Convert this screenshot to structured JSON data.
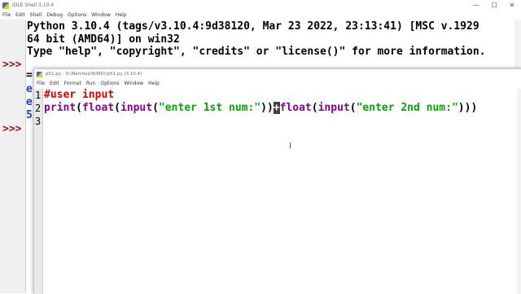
{
  "shell": {
    "title": "IDLE Shell 3.10.4",
    "window_controls": {
      "minimize": "—",
      "maximize": "☐",
      "close": "✕"
    },
    "menu": [
      "File",
      "Edit",
      "Shell",
      "Debug",
      "Options",
      "Window",
      "Help"
    ],
    "lines": [
      "Python 3.10.4 (tags/v3.10.4:9d38120, Mar 23 2022, 23:13:41) [MSC v.1929",
      "64 bit (AMD64)] on win32",
      "Type \"help\", \"copyright\", \"credits\" or \"license()\" for more information."
    ],
    "prompt": ">>>",
    "partial_chars": [
      "=",
      "e",
      "e",
      "5"
    ]
  },
  "editor": {
    "title": "p51.py - D:/Batches/9(WD)/p51.py (3.10.4)",
    "menu": [
      "File",
      "Edit",
      "Format",
      "Run",
      "Options",
      "Window",
      "Help"
    ],
    "line_numbers": [
      "1",
      "2",
      "3"
    ],
    "code": {
      "line1": "#user input",
      "line2": {
        "t1": "print",
        "t2": "(",
        "t3": "float",
        "t4": "(",
        "t5": "input",
        "t6": "(",
        "t7": "\"enter 1st num:\"",
        "t8": "))",
        "t9": "+",
        "t10": "float",
        "t11": "(",
        "t12": "input",
        "t13": "(",
        "t14": "\"enter 2nd num:\"",
        "t15": ")))"
      }
    }
  },
  "colors": {
    "prompt": "#a31515",
    "comment": "#dd0000",
    "builtin": "#900090",
    "string": "#00aa00"
  }
}
